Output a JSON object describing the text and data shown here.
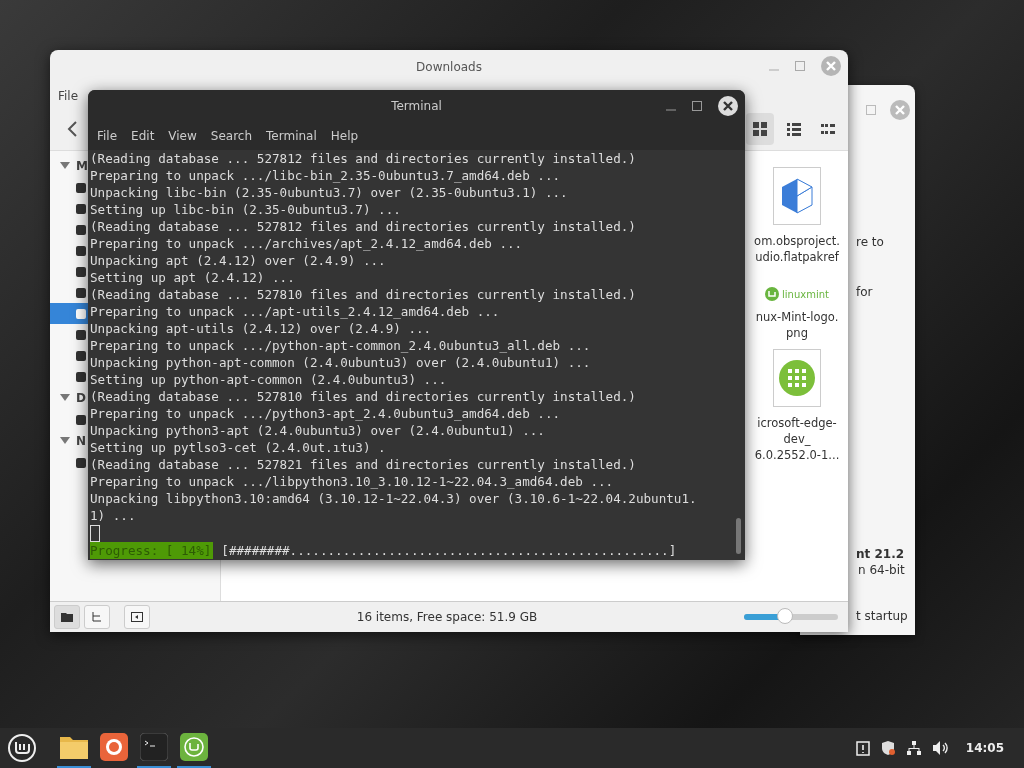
{
  "back_window": {
    "texts": [
      {
        "text": "re to",
        "kind": "plain"
      },
      {
        "text": "for",
        "kind": "plain"
      },
      {
        "text": "nt 21.2",
        "kind": "bold"
      },
      {
        "text": "n 64-bit",
        "kind": "plain"
      },
      {
        "text": "t startup",
        "kind": "plain"
      }
    ]
  },
  "file_manager": {
    "title": "Downloads",
    "menu": [
      "File"
    ],
    "view_buttons": [
      {
        "kind": "grid",
        "selected": true
      },
      {
        "kind": "list",
        "selected": false
      },
      {
        "kind": "compact",
        "selected": false
      }
    ],
    "sidebar": [
      {
        "kind": "header",
        "label": "M",
        "expanded": true
      },
      {
        "kind": "item",
        "selected": false
      },
      {
        "kind": "item",
        "selected": false
      },
      {
        "kind": "item",
        "selected": false
      },
      {
        "kind": "item",
        "selected": false
      },
      {
        "kind": "item",
        "selected": false
      },
      {
        "kind": "item",
        "selected": false
      },
      {
        "kind": "item",
        "selected": true
      },
      {
        "kind": "item",
        "selected": false
      },
      {
        "kind": "item",
        "selected": false
      },
      {
        "kind": "item",
        "selected": false
      },
      {
        "kind": "header",
        "label": "D",
        "expanded": true
      },
      {
        "kind": "item",
        "selected": false
      },
      {
        "kind": "header",
        "label": "N",
        "expanded": true
      },
      {
        "kind": "item",
        "selected": false
      }
    ],
    "files": [
      {
        "kind": "package",
        "name": "om.obsproject.\nudio.flatpakref"
      },
      {
        "kind": "logo",
        "logo_text": "linuxmint",
        "name": "nux-Mint-logo.\npng"
      },
      {
        "kind": "app",
        "name": "icrosoft-edge-\ndev_\n6.0.2552.0-1..."
      }
    ],
    "status": "16 items, Free space: 51.9 GB",
    "zoom": {
      "level": 0.45
    }
  },
  "terminal": {
    "title": "Terminal",
    "menu": [
      "File",
      "Edit",
      "View",
      "Search",
      "Terminal",
      "Help"
    ],
    "lines": [
      "(Reading database ... 527812 files and directories currently installed.)",
      "Preparing to unpack .../libc-bin_2.35-0ubuntu3.7_amd64.deb ...",
      "Unpacking libc-bin (2.35-0ubuntu3.7) over (2.35-0ubuntu3.1) ...",
      "Setting up libc-bin (2.35-0ubuntu3.7) ...",
      "(Reading database ... 527812 files and directories currently installed.)",
      "Preparing to unpack .../archives/apt_2.4.12_amd64.deb ...",
      "Unpacking apt (2.4.12) over (2.4.9) ...",
      "Setting up apt (2.4.12) ...",
      "(Reading database ... 527810 files and directories currently installed.)",
      "Preparing to unpack .../apt-utils_2.4.12_amd64.deb ...",
      "Unpacking apt-utils (2.4.12) over (2.4.9) ...",
      "Preparing to unpack .../python-apt-common_2.4.0ubuntu3_all.deb ...",
      "Unpacking python-apt-common (2.4.0ubuntu3) over (2.4.0ubuntu1) ...",
      "Setting up python-apt-common (2.4.0ubuntu3) ...",
      "(Reading database ... 527810 files and directories currently installed.)",
      "Preparing to unpack .../python3-apt_2.4.0ubuntu3_amd64.deb ...",
      "Unpacking python3-apt (2.4.0ubuntu3) over (2.4.0ubuntu1) ...",
      "Setting up pytlso3-cet (2.4.0ut.ıtu3) .",
      "(Reading database ... 527821 files and directories currently installed.)",
      "Preparing to unpack .../libpython3.10_3.10.12-1~22.04.3_amd64.deb ...",
      "Unpacking libpython3.10:amd64 (3.10.12-1~22.04.3) over (3.10.6-1~22.04.2ubuntu1.",
      "1) ..."
    ],
    "progress_label": "Progress: [ 14%]",
    "progress_bar": "[########..................................................]"
  },
  "taskbar": {
    "apps": [
      {
        "kind": "folder",
        "running": true
      },
      {
        "kind": "browser",
        "running": false
      },
      {
        "kind": "terminal",
        "running": true
      },
      {
        "kind": "mint",
        "running": true
      }
    ],
    "clock": "14:05"
  }
}
